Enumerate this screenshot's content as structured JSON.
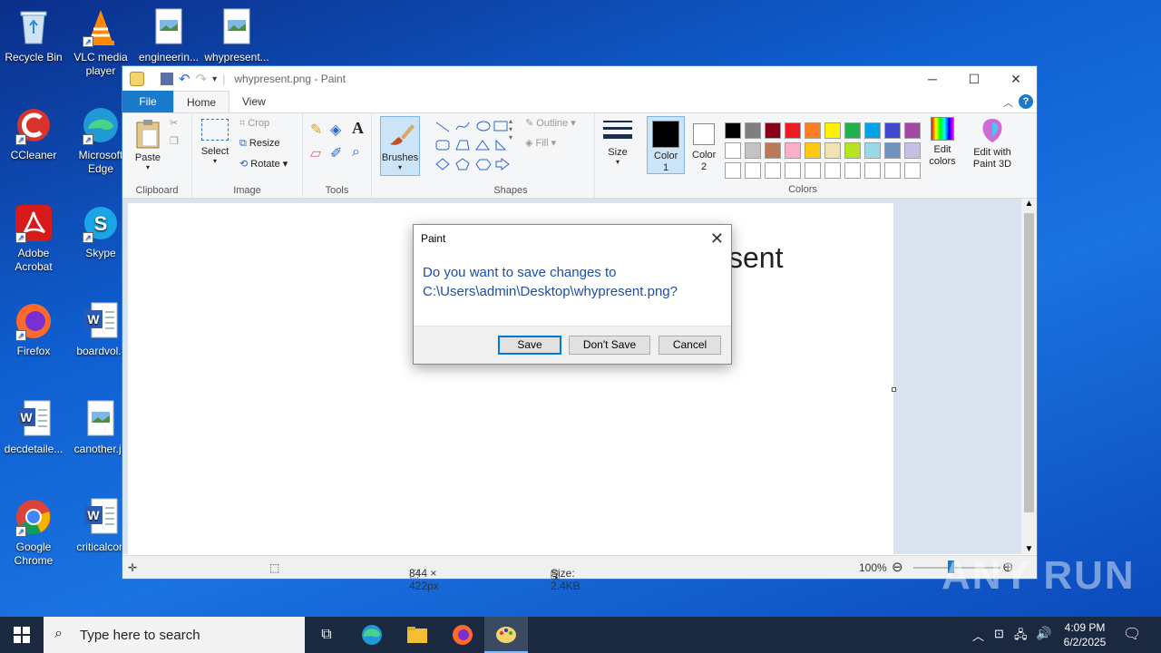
{
  "desktop": {
    "icons": [
      {
        "label": "Recycle Bin",
        "icon": "recycle-bin-icon"
      },
      {
        "label": "VLC media player",
        "icon": "vlc-icon"
      },
      {
        "label": "engineerin...",
        "icon": "image-file-icon"
      },
      {
        "label": "whypresent...",
        "icon": "image-file-icon"
      },
      {
        "label": "CCleaner",
        "icon": "ccleaner-icon"
      },
      {
        "label": "Microsoft Edge",
        "icon": "edge-icon"
      },
      {
        "label": "Adobe Acrobat",
        "icon": "acrobat-icon"
      },
      {
        "label": "Skype",
        "icon": "skype-icon"
      },
      {
        "label": "Firefox",
        "icon": "firefox-icon"
      },
      {
        "label": "boardvol.r",
        "icon": "word-doc-icon"
      },
      {
        "label": "decdetaile...",
        "icon": "word-doc-icon"
      },
      {
        "label": "canother.jp",
        "icon": "image-file-icon"
      },
      {
        "label": "Google Chrome",
        "icon": "chrome-icon"
      },
      {
        "label": "criticalcon",
        "icon": "word-doc-icon"
      }
    ]
  },
  "paint": {
    "title": "whypresent.png - Paint",
    "tabs": {
      "file": "File",
      "home": "Home",
      "view": "View"
    },
    "ribbon": {
      "clipboard": {
        "paste": "Paste",
        "label": "Clipboard"
      },
      "image": {
        "select": "Select",
        "crop": "Crop",
        "resize": "Resize",
        "rotate": "Rotate",
        "label": "Image"
      },
      "tools": {
        "label": "Tools"
      },
      "brushes": "Brushes",
      "shapes": {
        "outline": "Outline",
        "fill": "Fill",
        "label": "Shapes"
      },
      "size": "Size",
      "color1": "Color 1",
      "color2": "Color 2",
      "colors_label": "Colors",
      "edit_colors": "Edit colors",
      "edit_paint3d": "Edit with Paint 3D"
    },
    "palette_row1": [
      "#000000",
      "#7f7f7f",
      "#880015",
      "#ed1c24",
      "#ff7f27",
      "#fff200",
      "#22b14c",
      "#00a2e8",
      "#3f48cc",
      "#a349a4"
    ],
    "palette_row2": [
      "#ffffff",
      "#c3c3c3",
      "#b97a57",
      "#ffaec9",
      "#ffc90e",
      "#efe4b0",
      "#b5e61d",
      "#99d9ea",
      "#7092be",
      "#c8bfe7"
    ],
    "canvas_text": "sent",
    "status": {
      "dimensions": "844 × 422px",
      "size": "Size: 2.4KB",
      "zoom": "100%"
    }
  },
  "dialog": {
    "title": "Paint",
    "message_line1": "Do you want to save changes to",
    "message_line2": "C:\\Users\\admin\\Desktop\\whypresent.png?",
    "save": "Save",
    "dont_save": "Don't Save",
    "cancel": "Cancel"
  },
  "taskbar": {
    "search_placeholder": "Type here to search",
    "time": "4:09 PM",
    "date": "6/2/2025"
  },
  "watermark": "ANY RUN"
}
